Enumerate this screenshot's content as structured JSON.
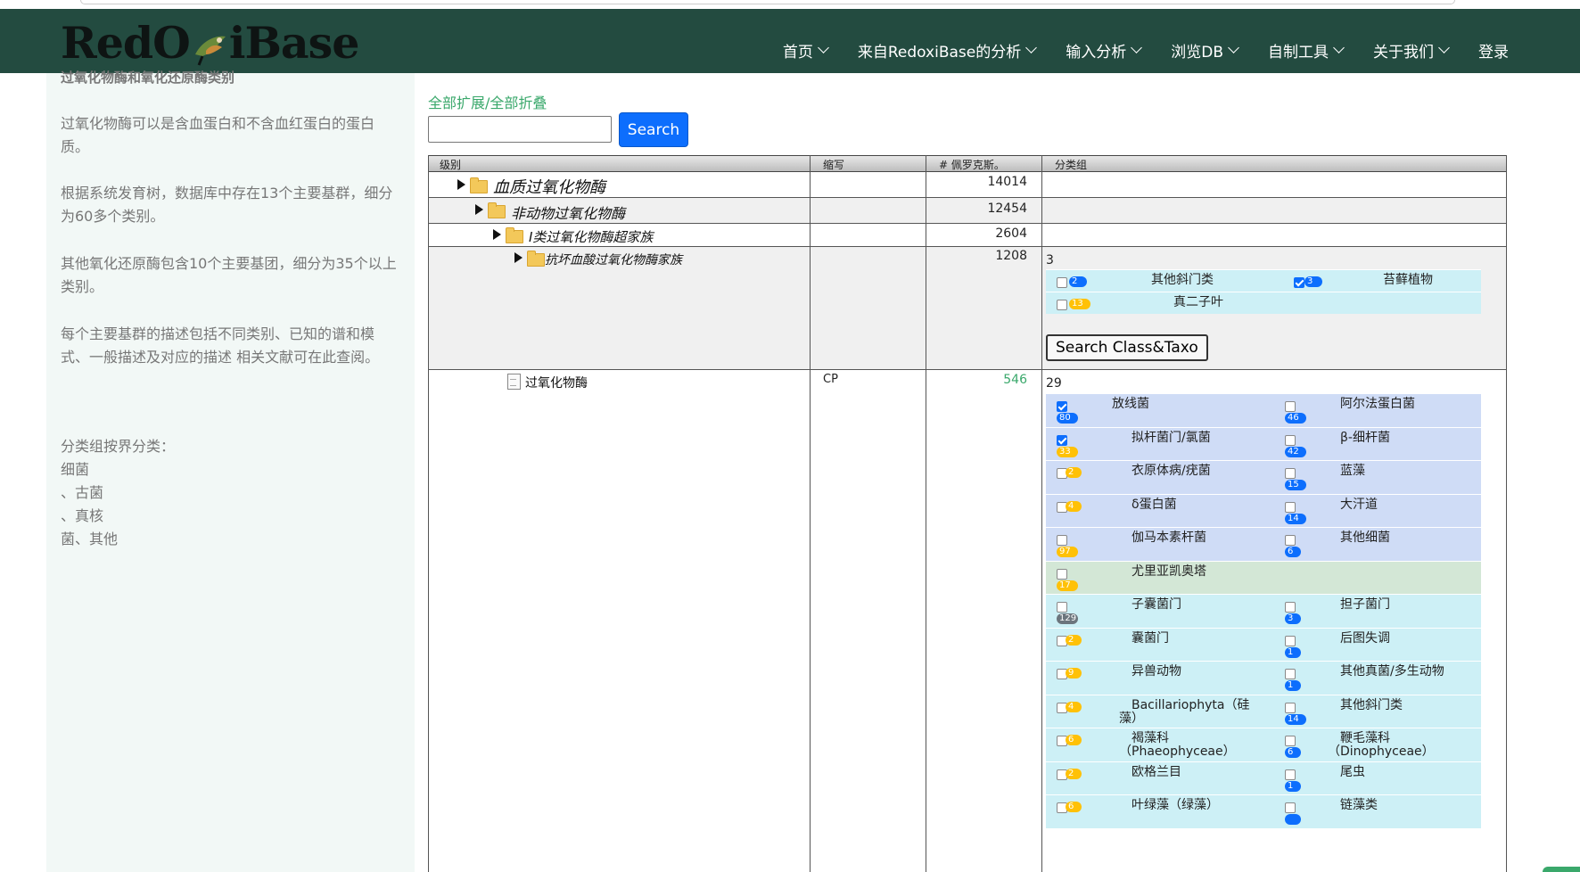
{
  "navbar": {
    "logo_text_a": "RedO",
    "logo_text_b": "iBase",
    "items": [
      {
        "label": "首页",
        "dropdown": true
      },
      {
        "label": "来自RedoxiBase的分析",
        "dropdown": true
      },
      {
        "label": "输入分析",
        "dropdown": true
      },
      {
        "label": "浏览DB",
        "dropdown": true
      },
      {
        "label": "自制工具",
        "dropdown": true
      },
      {
        "label": "关于我们",
        "dropdown": true
      },
      {
        "label": "登录",
        "dropdown": false
      }
    ]
  },
  "sidebar": {
    "title": "过氧化物酶和氧化还原酶类别",
    "p1": "过氧化物酶可以是含血蛋白和不含血红蛋白的蛋白质。",
    "p2": "根据系统发育树，数据库中存在13个主要基群，细分为60多个类别。",
    "p3": "其他氧化还原酶包含10个主要基团，细分为35个以上类别。",
    "p4": "每个主要基群的描述包括不同类别、已知的谱和模式、一般描述及对应的描述 相关文献可在此查阅。",
    "p5": [
      "分类组按界分类：",
      "细菌",
      "、古菌",
      "、真核",
      "菌、其他"
    ]
  },
  "main": {
    "expand_all": "全部扩展",
    "separator": "/",
    "collapse_all": "全部折叠",
    "search_placeholder": "",
    "search_label": "Search",
    "headers": [
      "级别",
      "缩写",
      "# 佩罗克斯。",
      "分类组"
    ],
    "rows": [
      {
        "label": "血质过氧化物酶",
        "abbr": "",
        "count": "14014"
      },
      {
        "label": "非动物过氧化物酶",
        "abbr": "",
        "count": "12454"
      },
      {
        "label": "I类过氧化物酶超家族",
        "abbr": "",
        "count": "2604"
      },
      {
        "label": "抗坏血酸过氧化物酶家族",
        "abbr": "",
        "count": "1208"
      },
      {
        "label": "过氧化物酶",
        "abbr": "CP",
        "count": "546"
      }
    ],
    "taxo1": {
      "count": "3",
      "items": [
        {
          "name": "其他斜门类",
          "badge": "2",
          "color": "blue",
          "checked": false
        },
        {
          "name": "苔藓植物",
          "badge": "3",
          "color": "blue",
          "checked": true
        },
        {
          "name": "真二子叶",
          "badge": "13",
          "color": "yellow",
          "checked": false
        }
      ],
      "button": "Search Class&Taxo"
    },
    "taxo2": {
      "count": "29",
      "rows": [
        {
          "bg": "#cfdcf6",
          "left": {
            "name": "放线菌",
            "badge": "80",
            "color": "blue",
            "checked": true,
            "badge_below": true
          },
          "right": {
            "name": "阿尔法蛋白菌",
            "badge": "46",
            "color": "blue",
            "checked": false
          }
        },
        {
          "bg": "#cfdcf6",
          "left": {
            "name": "拟杆菌门/氯菌",
            "badge": "33",
            "color": "yellow",
            "checked": true,
            "badge_below": true
          },
          "right": {
            "name": "β-细杆菌",
            "badge": "42",
            "color": "blue",
            "checked": false
          }
        },
        {
          "bg": "#cfdcf6",
          "left": {
            "name": "衣原体病/疣菌",
            "badge": "2",
            "color": "yellow",
            "checked": false
          },
          "right": {
            "name": "蓝藻",
            "badge": "15",
            "color": "blue",
            "checked": false
          }
        },
        {
          "bg": "#cfdcf6",
          "left": {
            "name": "δ蛋白菌",
            "badge": "4",
            "color": "yellow",
            "checked": false
          },
          "right": {
            "name": "大汗道",
            "badge": "14",
            "color": "blue",
            "checked": false
          }
        },
        {
          "bg": "#cfdcf6",
          "left": {
            "name": "伽马本素杆菌",
            "badge": "97",
            "color": "yellow",
            "checked": false,
            "badge_below": true
          },
          "right": {
            "name": "其他细菌",
            "badge": "6",
            "color": "blue",
            "checked": false
          }
        },
        {
          "bg": "#d3e7d6",
          "left": {
            "name": "尤里亚凯奥塔",
            "badge": "17",
            "color": "yellow",
            "checked": false,
            "badge_below": true
          },
          "right": null
        },
        {
          "bg": "#cdf0f6",
          "left": {
            "name": "子囊菌门",
            "badge": "129",
            "color": "gray",
            "checked": false,
            "badge_below": true
          },
          "right": {
            "name": "担子菌门",
            "badge": "3",
            "color": "blue",
            "checked": false
          }
        },
        {
          "bg": "#cdf0f6",
          "left": {
            "name": "囊菌门",
            "badge": "2",
            "color": "yellow",
            "checked": false
          },
          "right": {
            "name": "后图失调",
            "badge": "1",
            "color": "blue",
            "checked": false
          }
        },
        {
          "bg": "#cdf0f6",
          "left": {
            "name": "异兽动物",
            "badge": "9",
            "color": "yellow",
            "checked": false
          },
          "right": {
            "name": "其他真菌/多生动物",
            "badge": "1",
            "color": "blue",
            "checked": false
          }
        },
        {
          "bg": "#cdf0f6",
          "left": {
            "name": "Bacillariophyta（硅",
            "name2": "藻）",
            "badge": "4",
            "color": "yellow",
            "checked": false
          },
          "right": {
            "name": "其他斜门类",
            "badge": "14",
            "color": "blue",
            "checked": false
          }
        },
        {
          "bg": "#cdf0f6",
          "left": {
            "name": "褐藻科",
            "name2": "（Phaeophyceae）",
            "badge": "6",
            "color": "yellow",
            "checked": false
          },
          "right": {
            "name": "鞭毛藻科",
            "name2": "（Dinophyceae）",
            "badge": "6",
            "color": "blue",
            "checked": false
          }
        },
        {
          "bg": "#cdf0f6",
          "left": {
            "name": "欧格兰目",
            "badge": "2",
            "color": "yellow",
            "checked": false
          },
          "right": {
            "name": "尾虫",
            "badge": "1",
            "color": "blue",
            "checked": false
          }
        },
        {
          "bg": "#cdf0f6",
          "left": {
            "name": "叶绿藻（绿藻）",
            "badge": "6",
            "color": "yellow",
            "checked": false
          },
          "right": {
            "name": "链藻类",
            "badge": "",
            "color": "blue",
            "checked": false
          }
        }
      ]
    }
  }
}
